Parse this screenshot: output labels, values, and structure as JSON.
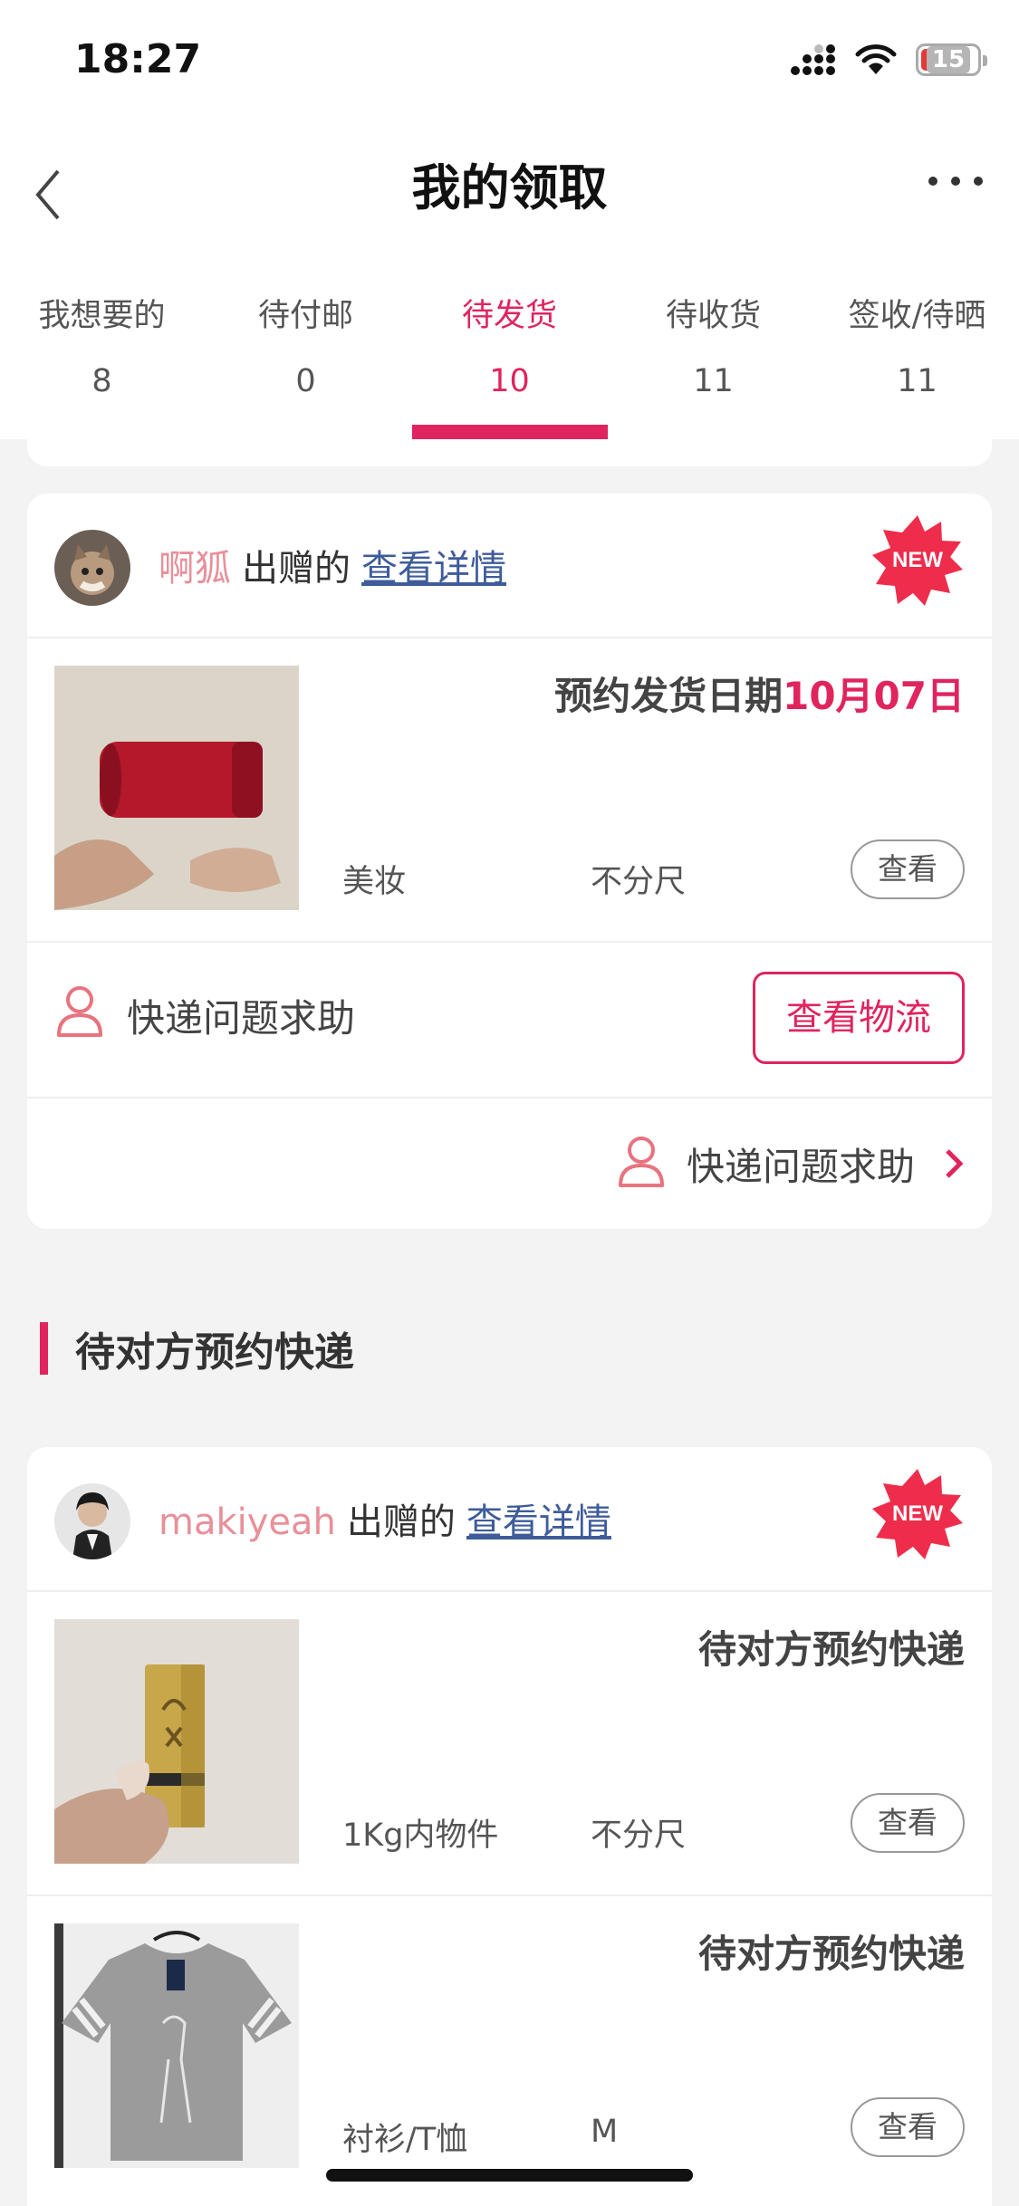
{
  "status_bar": {
    "time": "18:27",
    "battery": "15"
  },
  "nav": {
    "title": "我的领取"
  },
  "tabs": [
    {
      "label": "我想要的",
      "count": "8"
    },
    {
      "label": "待付邮",
      "count": "0"
    },
    {
      "label": "待发货",
      "count": "10"
    },
    {
      "label": "待收货",
      "count": "11"
    },
    {
      "label": "签收/待晒",
      "count": "11"
    }
  ],
  "active_tab": "待发货",
  "accent_color": "#e0245e",
  "cards": [
    {
      "giver": "啊狐",
      "gives_text": "出赠的",
      "detail_link": "查看详情",
      "badge": "NEW",
      "products": [
        {
          "status_prefix": "预约发货日期",
          "status_highlight": "10月07日",
          "category": "美妆",
          "size": "不分尺",
          "view_label": "查看"
        }
      ],
      "help_text": "快递问题求助",
      "logistics_button": "查看物流",
      "help_link": "快递问题求助"
    },
    {
      "giver": "makiyeah",
      "gives_text": "出赠的",
      "detail_link": "查看详情",
      "badge": "NEW",
      "products": [
        {
          "status_prefix": "待对方预约快递",
          "category": "1Kg内物件",
          "size": "不分尺",
          "view_label": "查看"
        },
        {
          "status_prefix": "待对方预约快递",
          "category": "衬衫/T恤",
          "size": "M",
          "view_label": "查看"
        }
      ]
    }
  ],
  "section": {
    "title": "待对方预约快递"
  }
}
